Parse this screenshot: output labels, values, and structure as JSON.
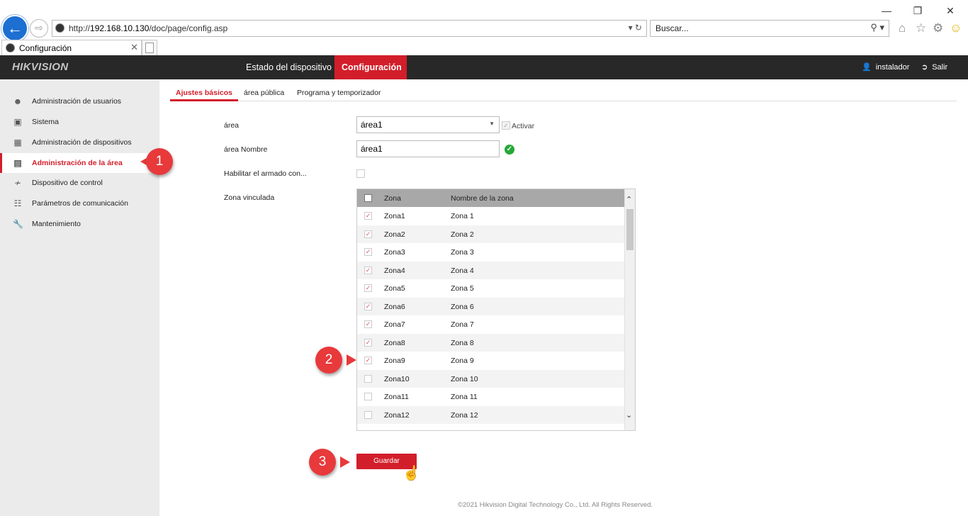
{
  "browser": {
    "url_prefix": "http://",
    "url_host": "192.168.10.130",
    "url_path": "/doc/page/config.asp",
    "search_placeholder": "Buscar...",
    "tab_title": "Configuración",
    "window_controls": [
      "minimize-icon",
      "restore-icon",
      "close-icon"
    ],
    "toolbar_icons": [
      "home-icon",
      "star-icon",
      "gear-icon",
      "smiley-icon"
    ]
  },
  "header": {
    "logo": "HIKVISION",
    "nav": [
      "Estado del dispositivo",
      "Configuración"
    ],
    "active_nav": "Configuración",
    "user": "instalador",
    "logout": "Salir",
    "accent_color": "#d21e2a"
  },
  "sidebar": {
    "items": [
      {
        "label": "Administración de usuarios",
        "icon": "user-icon"
      },
      {
        "label": "Sistema",
        "icon": "system-icon"
      },
      {
        "label": "Administración de dispositivos",
        "icon": "devices-icon"
      },
      {
        "label": "Administración de la área",
        "icon": "area-icon",
        "active": true
      },
      {
        "label": "Dispositivo de control",
        "icon": "control-device-icon"
      },
      {
        "label": "Parámetros de comunicación",
        "icon": "network-icon"
      },
      {
        "label": "Mantenimiento",
        "icon": "wrench-icon"
      }
    ]
  },
  "subtabs": [
    "Ajustes básicos",
    "área pública",
    "Programa y temporizador"
  ],
  "form": {
    "area_label": "área",
    "area_value": "área1",
    "activar_label": "Activar",
    "area_name_label": "área Nombre",
    "area_name_value": "área1",
    "arm_label": "Habilitar el armado con...",
    "linked_zone_label": "Zona vinculada"
  },
  "zone_table": {
    "columns": [
      "Zona",
      "Nombre de la zona"
    ],
    "rows": [
      {
        "zone": "Zona1",
        "name": "Zona 1",
        "checked": true
      },
      {
        "zone": "Zona2",
        "name": "Zona 2",
        "checked": true
      },
      {
        "zone": "Zona3",
        "name": "Zona 3",
        "checked": true
      },
      {
        "zone": "Zona4",
        "name": "Zona 4",
        "checked": true
      },
      {
        "zone": "Zona5",
        "name": "Zona 5",
        "checked": true
      },
      {
        "zone": "Zona6",
        "name": "Zona 6",
        "checked": true
      },
      {
        "zone": "Zona7",
        "name": "Zona 7",
        "checked": true
      },
      {
        "zone": "Zona8",
        "name": "Zona 8",
        "checked": true
      },
      {
        "zone": "Zona9",
        "name": "Zona 9",
        "checked": true
      },
      {
        "zone": "Zona10",
        "name": "Zona 10",
        "checked": false
      },
      {
        "zone": "Zona11",
        "name": "Zona 11",
        "checked": false
      },
      {
        "zone": "Zona12",
        "name": "Zona 12",
        "checked": false
      }
    ]
  },
  "save_label": "Guardar",
  "callouts": [
    "1",
    "2",
    "3"
  ],
  "footer": "©2021 Hikvision Digital Technology Co., Ltd. All Rights Reserved."
}
